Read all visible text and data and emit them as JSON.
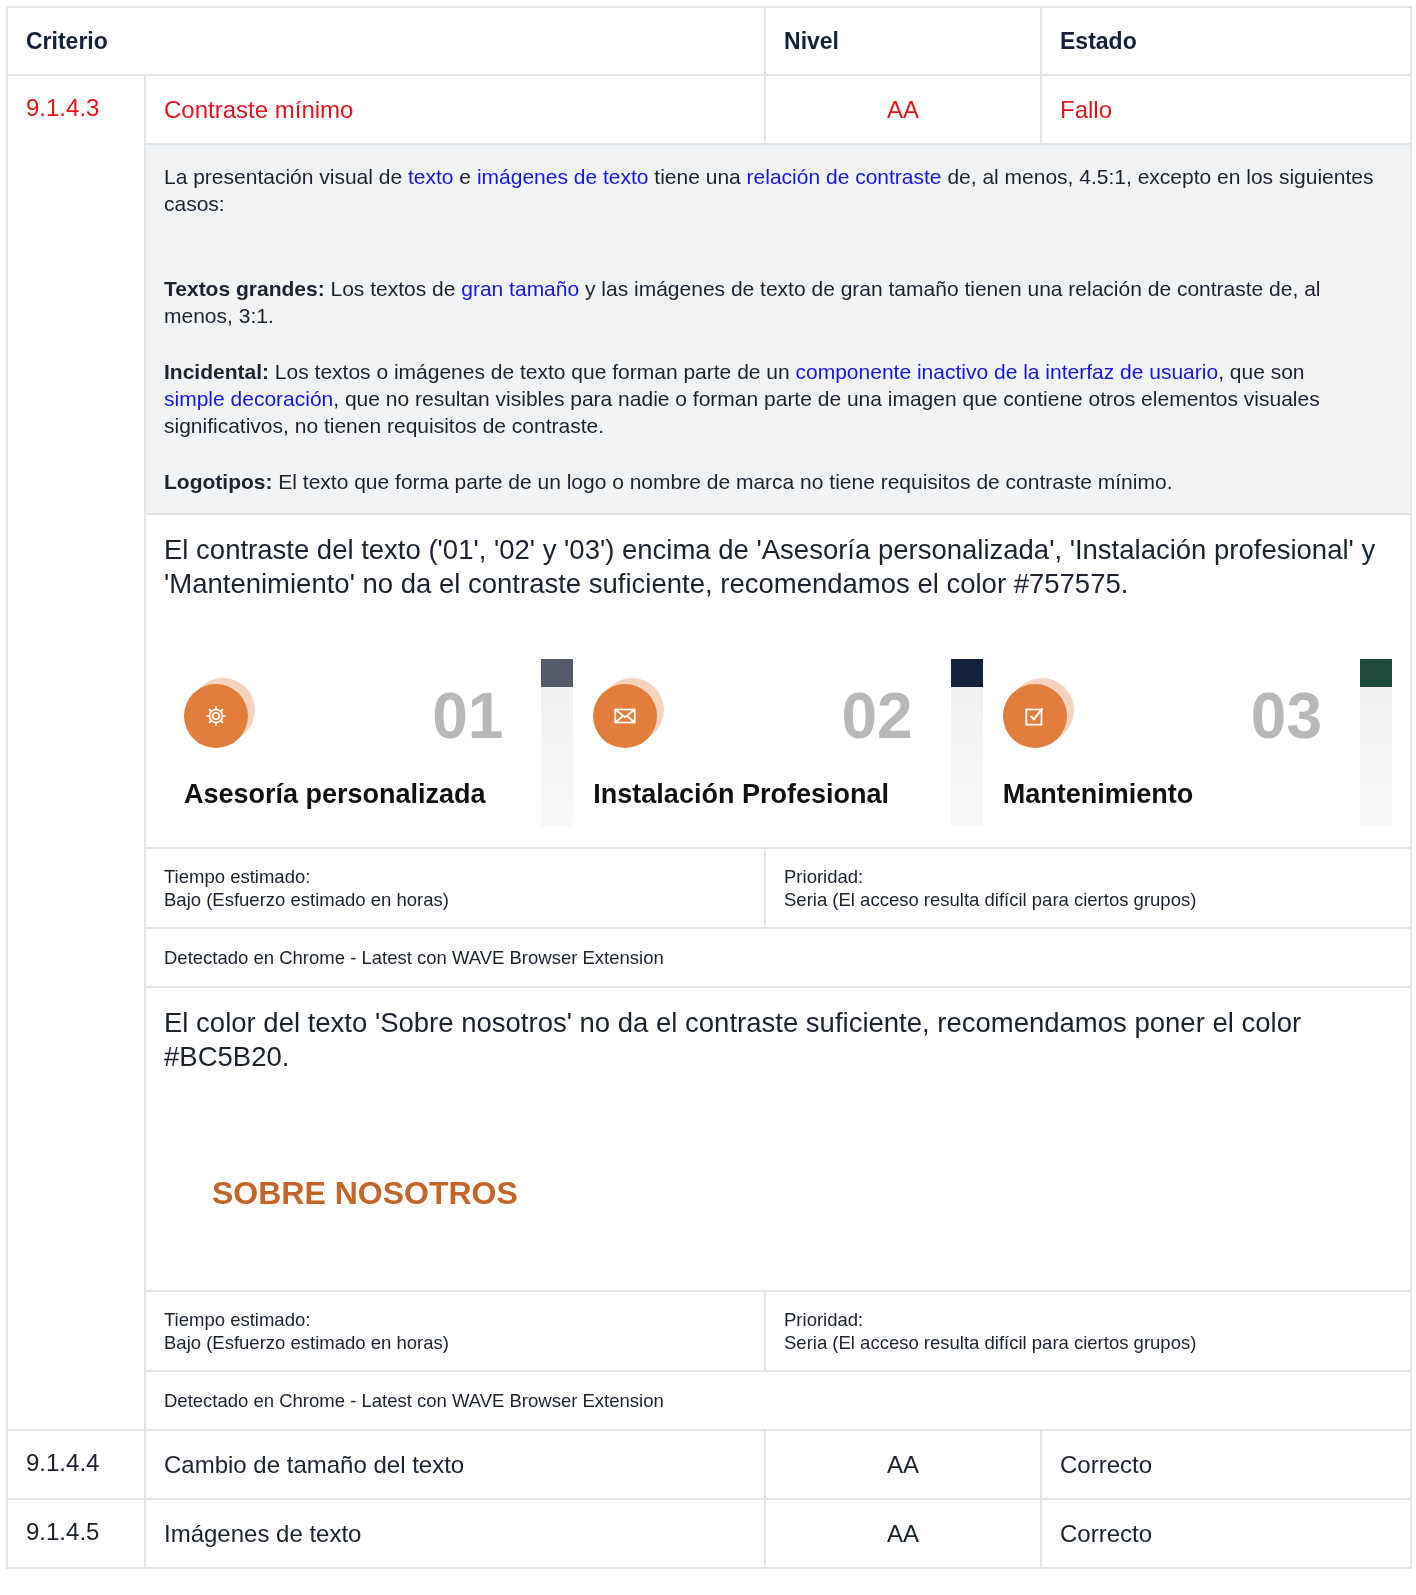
{
  "columns": [
    "Criterio",
    "Nivel",
    "Estado"
  ],
  "rows": [
    {
      "id": "9.1.4.3",
      "name": "Contraste mínimo",
      "level": "AA",
      "status": "Fallo",
      "failed": true,
      "description": [
        {
          "parts": [
            {
              "kind": "text",
              "text": "La presentación visual de "
            },
            {
              "kind": "link",
              "text": "texto"
            },
            {
              "kind": "text",
              "text": " e "
            },
            {
              "kind": "link",
              "text": "imágenes de texto"
            },
            {
              "kind": "text",
              "text": " tiene una "
            },
            {
              "kind": "link",
              "text": "relación de contraste"
            },
            {
              "kind": "text",
              "text": " de, al menos, 4.5:1, excepto en los siguientes casos:"
            }
          ]
        },
        {
          "parts": [
            {
              "kind": "bold",
              "text": "Textos grandes:"
            },
            {
              "kind": "text",
              "text": " Los textos de "
            },
            {
              "kind": "link",
              "text": "gran tamaño"
            },
            {
              "kind": "text",
              "text": " y las imágenes de texto de gran tamaño tienen una relación de contraste de, al menos, 3:1."
            }
          ]
        },
        {
          "parts": [
            {
              "kind": "bold",
              "text": "Incidental:"
            },
            {
              "kind": "text",
              "text": " Los textos o imágenes de texto que forman parte de un "
            },
            {
              "kind": "link",
              "text": "componente inactivo de la interfaz de usuario"
            },
            {
              "kind": "text",
              "text": ", que son "
            },
            {
              "kind": "link",
              "text": "simple decoración"
            },
            {
              "kind": "text",
              "text": ", que no resultan visibles para nadie o forman parte de una imagen que contiene otros elementos visuales significativos, no tienen requisitos de contraste."
            }
          ]
        },
        {
          "parts": [
            {
              "kind": "bold",
              "text": "Logotipos:"
            },
            {
              "kind": "text",
              "text": " El texto que forma parte de un logo o nombre de marca no tiene requisitos de contraste mínimo."
            }
          ]
        }
      ],
      "issues": [
        {
          "text": "El contraste del texto ('01', '02' y '03') encima de 'Asesoría personalizada', 'Instalación profesional' y 'Mantenimiento' no da el contraste suficiente, recomendamos el color #757575.",
          "capture": {
            "kind": "cards",
            "cards": [
              {
                "number": "01",
                "title": "Asesoría personalizada"
              },
              {
                "number": "02",
                "title": "Instalación Profesional"
              },
              {
                "number": "03",
                "title": "Mantenimiento"
              }
            ]
          },
          "time_label": "Tiempo estimado:",
          "time": "Bajo (Esfuerzo estimado en horas)",
          "priority_label": "Prioridad:",
          "priority": "Seria (El acceso resulta difícil para ciertos grupos)",
          "detected": "Detectado en Chrome - Latest con WAVE Browser Extension"
        },
        {
          "text": "El color del texto 'Sobre nosotros' no da el contraste suficiente, recomendamos poner el color #BC5B20.",
          "capture": {
            "kind": "heading",
            "text": "SOBRE NOSOTROS"
          },
          "time_label": "Tiempo estimado:",
          "time": "Bajo (Esfuerzo estimado en horas)",
          "priority_label": "Prioridad:",
          "priority": "Seria (El acceso resulta difícil para ciertos grupos)",
          "detected": "Detectado en Chrome - Latest con WAVE Browser Extension"
        }
      ]
    },
    {
      "id": "9.1.4.4",
      "name": "Cambio de tamaño del texto",
      "level": "AA",
      "status": "Correcto",
      "failed": false
    },
    {
      "id": "9.1.4.5",
      "name": "Imágenes de texto",
      "level": "AA",
      "status": "Correcto",
      "failed": false
    }
  ]
}
